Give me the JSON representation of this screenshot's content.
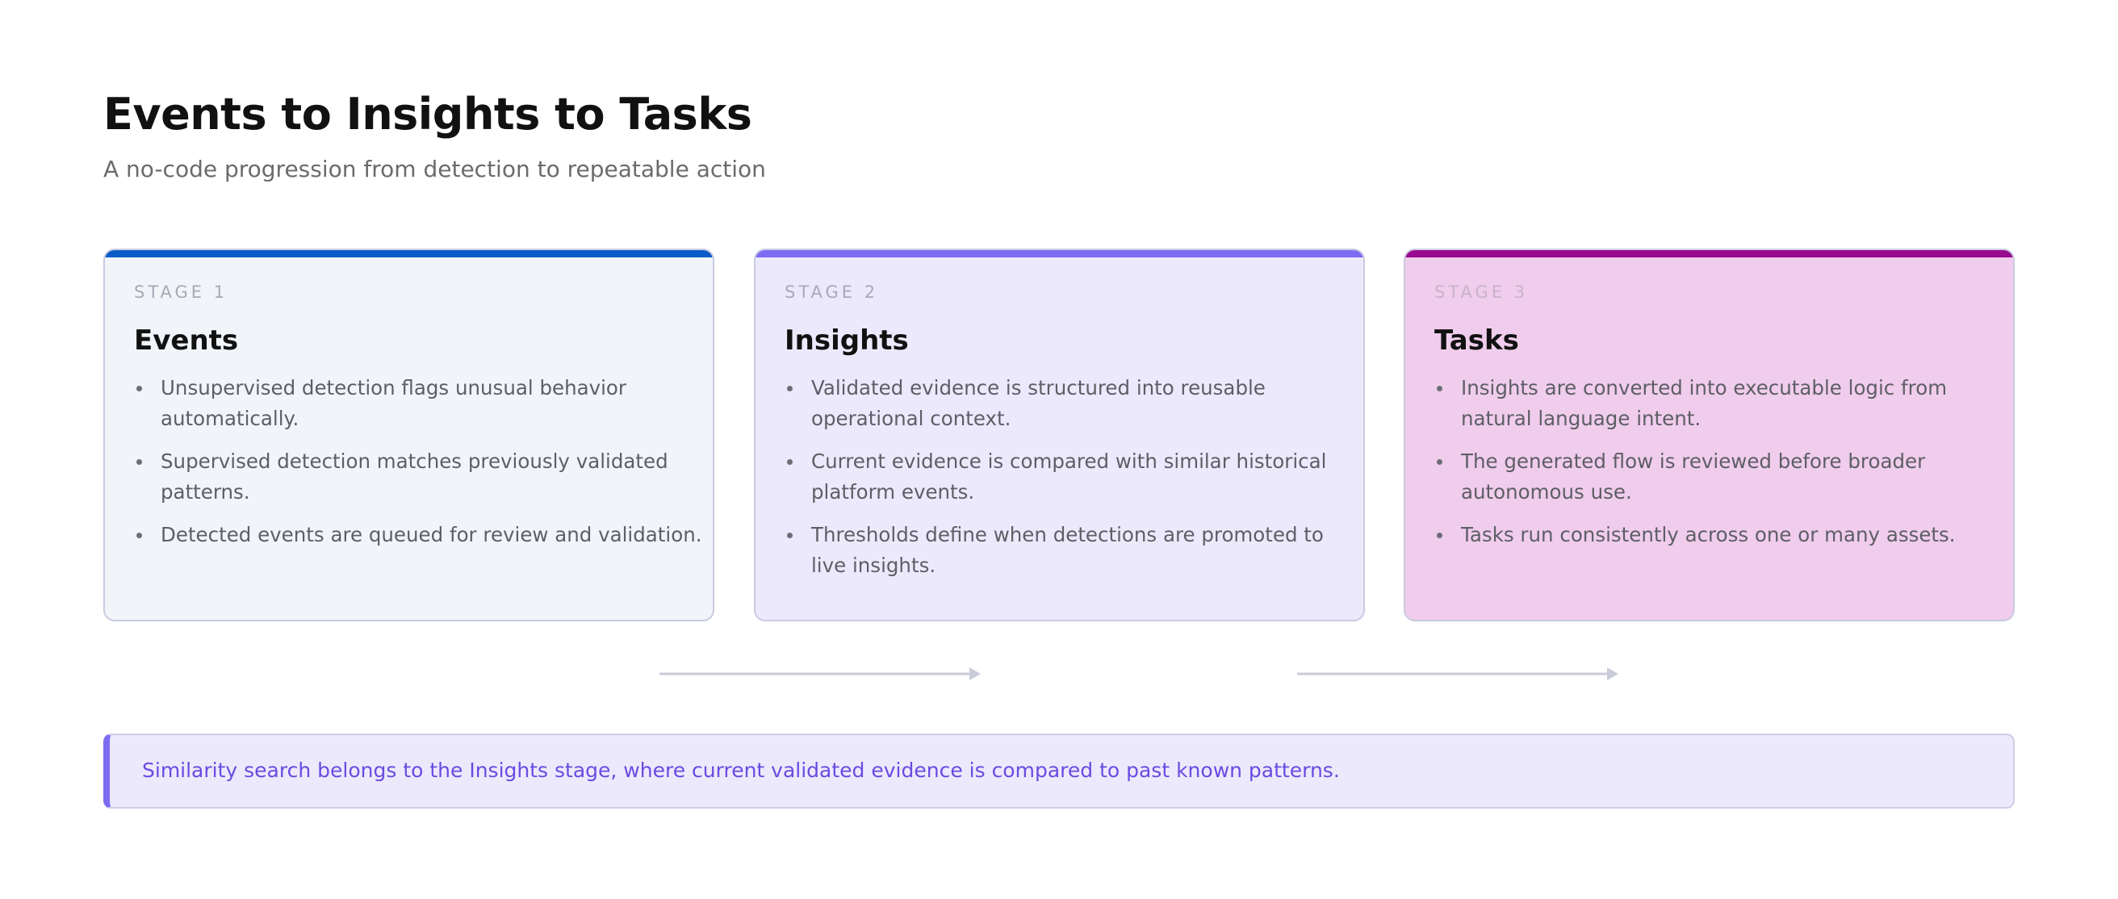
{
  "header": {
    "title": "Events to Insights to Tasks",
    "subtitle": "A no-code progression from detection to repeatable action"
  },
  "stages": [
    {
      "stage_label": "STAGE 1",
      "title": "Events",
      "accent": "#0a5bc8",
      "bullets": [
        "Unsupervised detection flags unusual behavior automatically.",
        "Supervised detection matches previously validated patterns.",
        "Detected events are queued for review and validation."
      ]
    },
    {
      "stage_label": "STAGE 2",
      "title": "Insights",
      "accent": "#7c6cf2",
      "bullets": [
        "Validated evidence is structured into reusable operational context.",
        "Current evidence is compared with similar historical platform events.",
        "Thresholds define when detections are promoted to live insights."
      ]
    },
    {
      "stage_label": "STAGE 3",
      "title": "Tasks",
      "accent": "#990a8f",
      "bullets": [
        "Insights are converted into executable logic from natural language intent.",
        "The generated flow is reviewed before broader autonomous use.",
        "Tasks run consistently across one or many assets."
      ]
    }
  ],
  "note": {
    "text": "Similarity search belongs to the Insights stage, where current validated evidence is compared to past known patterns.",
    "accent": "#7c6cf2"
  }
}
